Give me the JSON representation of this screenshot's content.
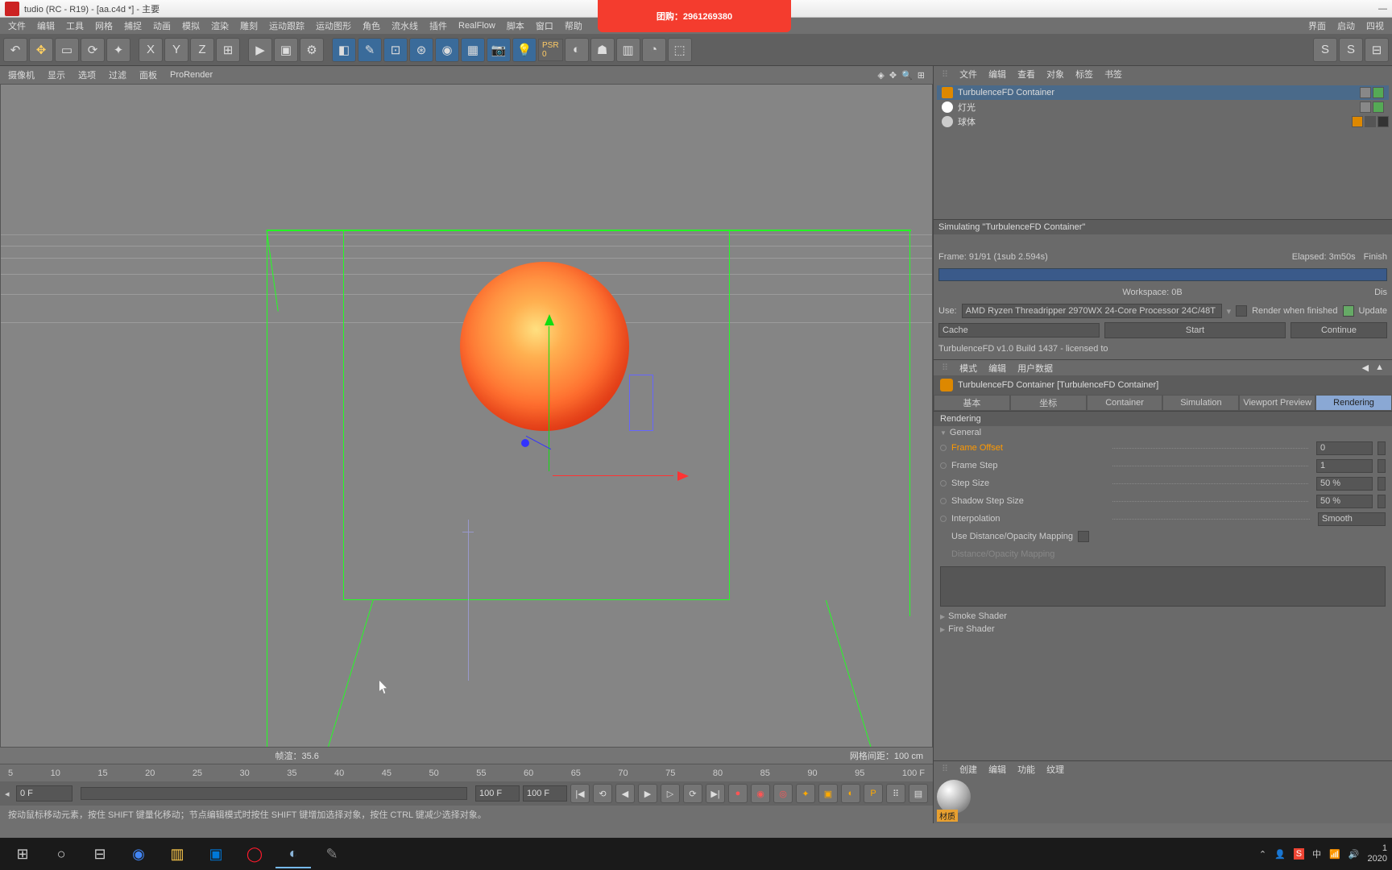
{
  "titlebar": {
    "title": "tudio (RC - R19) - [aa.c4d *] - 主要"
  },
  "menubar": {
    "items": [
      "文件",
      "编辑",
      "工具",
      "网格",
      "捕捉",
      "动画",
      "模拟",
      "渲染",
      "雕刻",
      "运动跟踪",
      "运动图形",
      "角色",
      "流水线",
      "插件",
      "RealFlow",
      "脚本",
      "窗口",
      "帮助"
    ],
    "right": [
      "界面",
      "启动",
      "四视"
    ]
  },
  "vp_menu": {
    "items": [
      "摄像机",
      "显示",
      "选项",
      "过滤",
      "面板",
      "ProRender"
    ]
  },
  "vp_status": {
    "speed": "帧渲：35.6",
    "grid": "网格间距：100 cm"
  },
  "timeline": {
    "ticks": [
      "5",
      "10",
      "15",
      "20",
      "25",
      "30",
      "35",
      "40",
      "45",
      "50",
      "55",
      "60",
      "65",
      "70",
      "75",
      "80",
      "85",
      "90",
      "95",
      "100 F"
    ],
    "cur": "0 F",
    "start": "0 F",
    "end_a": "100 F",
    "end_b": "100 F",
    "pos_label": "0 F"
  },
  "statusbar": {
    "text": "按动鼠标移动元素，按住 SHIFT 键量化移动；节点编辑模式时按住 SHIFT 键增加选择对象，按住 CTRL 键减少选择对象。"
  },
  "obj_menu": {
    "items": [
      "文件",
      "编辑",
      "查看",
      "对象",
      "标签",
      "书签"
    ]
  },
  "objects": [
    {
      "name": "TurbulenceFD Container",
      "sel": true,
      "ico": "#d80"
    },
    {
      "name": "灯光",
      "sel": false,
      "ico": "#fff"
    },
    {
      "name": "球体",
      "sel": false,
      "ico": "#ccc"
    }
  ],
  "sim": {
    "title": "Simulating \"TurbulenceFD Container\"",
    "frame": "Frame: 91/91 (1sub 2.594s)",
    "elapsed": "Elapsed: 3m50s",
    "finish": "Finish",
    "workspace": "Workspace: 0B",
    "disk": "Dis",
    "use": "Use:",
    "cpu": "AMD Ryzen Threadripper 2970WX 24-Core Processor 24C/48T",
    "render_chk": "Render when finished",
    "update": "Update",
    "cache": "Cache",
    "start": "Start",
    "continue": "Continue",
    "license": "TurbulenceFD v1.0 Build 1437 - licensed to"
  },
  "attr_menu": {
    "items": [
      "模式",
      "编辑",
      "用户数据"
    ]
  },
  "attr_obj": {
    "name": "TurbulenceFD Container [TurbulenceFD Container]"
  },
  "tabs": [
    "基本",
    "坐标",
    "Container",
    "Simulation",
    "Viewport Preview",
    "Rendering"
  ],
  "section": "Rendering",
  "group_general": "General",
  "params": {
    "frame_offset": {
      "lbl": "Frame Offset",
      "val": "0"
    },
    "frame_step": {
      "lbl": "Frame Step",
      "val": "1"
    },
    "step_size": {
      "lbl": "Step Size",
      "val": "50 %"
    },
    "shadow_step": {
      "lbl": "Shadow Step Size",
      "val": "50 %"
    },
    "interp": {
      "lbl": "Interpolation",
      "val": "Smooth"
    },
    "use_dist": {
      "lbl": "Use Distance/Opacity Mapping"
    },
    "dist_map": {
      "lbl": "Distance/Opacity Mapping"
    }
  },
  "group_smoke": "Smoke Shader",
  "group_fire": "Fire Shader",
  "mat_menu": {
    "items": [
      "创建",
      "编辑",
      "功能",
      "纹理"
    ]
  },
  "mat": {
    "label": "材质"
  },
  "overlay": {
    "text": "团购：2961269380"
  },
  "tray": {
    "time": "1",
    "date": "2020"
  }
}
